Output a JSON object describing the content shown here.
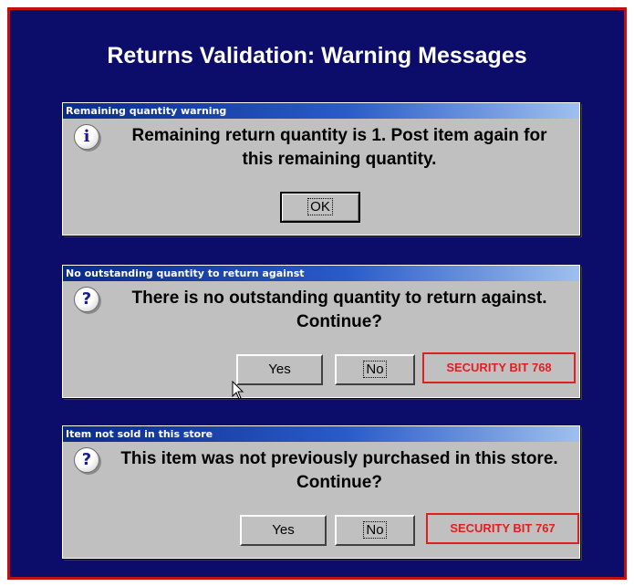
{
  "slide": {
    "title": "Returns Validation: Warning Messages",
    "background": "#0c0c6b",
    "border_color": "#c01010"
  },
  "dialogs": [
    {
      "title": "Remaining quantity warning",
      "icon": "info-icon",
      "icon_glyph": "i",
      "message": "Remaining return quantity is 1.  Post item again for this remaining quantity.",
      "buttons": [
        "OK"
      ]
    },
    {
      "title": "No outstanding quantity to return against",
      "icon": "question-icon",
      "icon_glyph": "?",
      "message": "There is no outstanding quantity to return against. Continue?",
      "buttons": [
        "Yes",
        "No"
      ],
      "security_label": "SECURITY BIT 768"
    },
    {
      "title": "Item not sold in this store",
      "icon": "question-icon",
      "icon_glyph": "?",
      "message": "This item was not previously purchased in this store. Continue?",
      "buttons": [
        "Yes",
        "No"
      ],
      "security_label": "SECURITY BIT 767"
    }
  ],
  "colors": {
    "security_red": "#e02020",
    "dialog_gray": "#c0c0c0"
  }
}
